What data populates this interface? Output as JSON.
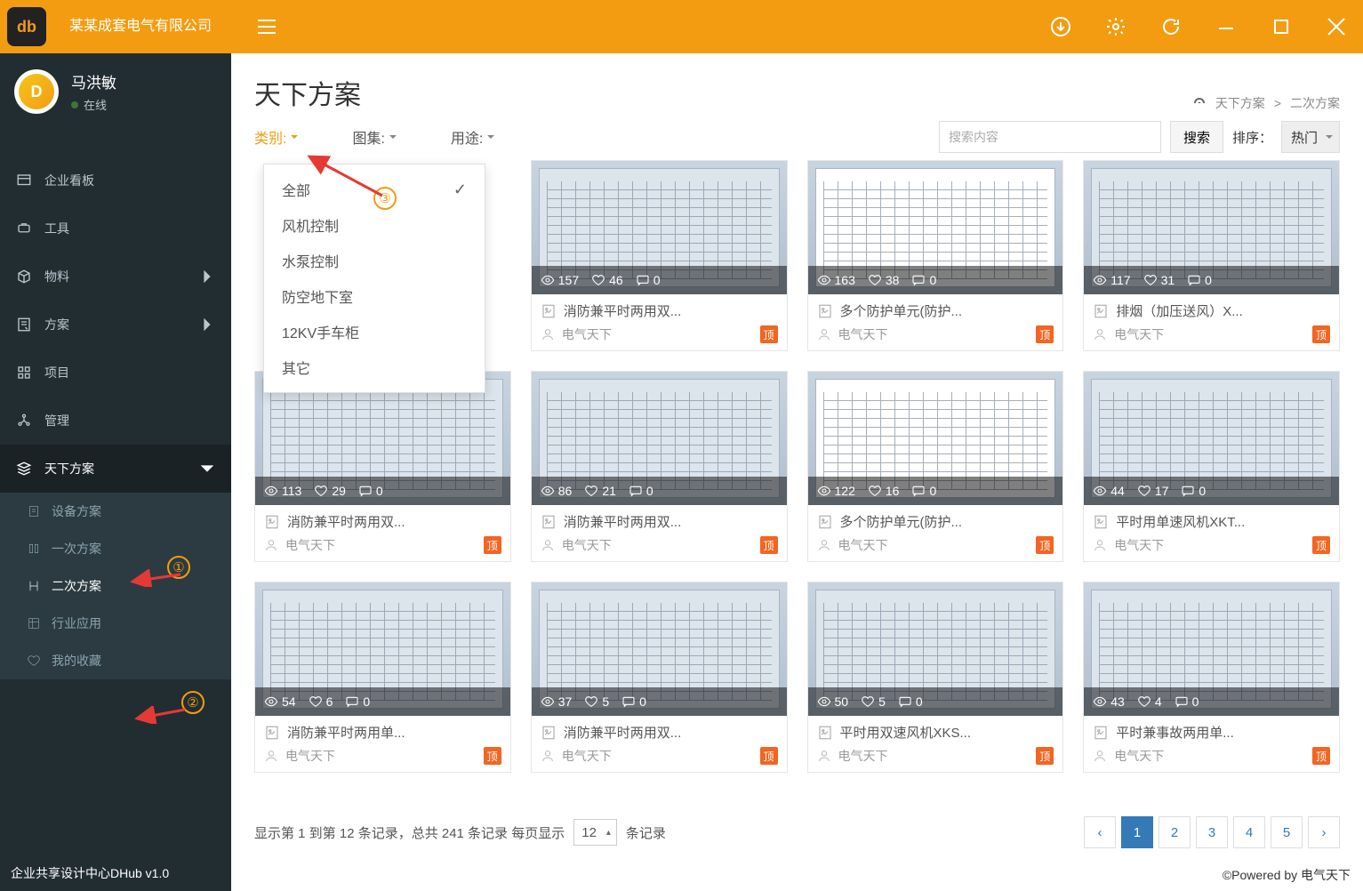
{
  "app": {
    "company": "某某成套电气有限公司",
    "footer_left": "企业共享设计中心DHub v1.0",
    "footer_right": "©Powered by 电气天下"
  },
  "user": {
    "name": "马洪敏",
    "status": "在线"
  },
  "sidebar": {
    "items": [
      {
        "label": "企业看板"
      },
      {
        "label": "工具"
      },
      {
        "label": "物料"
      },
      {
        "label": "方案"
      },
      {
        "label": "项目"
      },
      {
        "label": "管理"
      },
      {
        "label": "天下方案"
      }
    ],
    "sub": [
      {
        "label": "设备方案"
      },
      {
        "label": "一次方案"
      },
      {
        "label": "二次方案"
      },
      {
        "label": "行业应用"
      },
      {
        "label": "我的收藏"
      }
    ]
  },
  "page": {
    "title": "天下方案",
    "breadcrumb_root": "天下方案",
    "breadcrumb_leaf": "二次方案"
  },
  "filters": {
    "category": "类别:",
    "gallery": "图集:",
    "usage": "用途:"
  },
  "dropdown": [
    "全部",
    "风机控制",
    "水泵控制",
    "防空地下室",
    "12KV手车柜",
    "其它"
  ],
  "search": {
    "placeholder": "搜索内容",
    "btn": "搜索"
  },
  "sort": {
    "label": "排序：",
    "value": "热门"
  },
  "cards": [
    {
      "views": "157",
      "likes": "46",
      "comments": "0",
      "title": "消防兼平时两用双...",
      "author": "电气天下"
    },
    {
      "views": "163",
      "likes": "38",
      "comments": "0",
      "title": "多个防护单元(防护...",
      "author": "电气天下",
      "white": true
    },
    {
      "views": "117",
      "likes": "31",
      "comments": "0",
      "title": "排烟（加压送风）X...",
      "author": "电气天下"
    },
    {
      "views": "113",
      "likes": "29",
      "comments": "0",
      "title": "消防兼平时两用双...",
      "author": "电气天下"
    },
    {
      "views": "86",
      "likes": "21",
      "comments": "0",
      "title": "消防兼平时两用双...",
      "author": "电气天下"
    },
    {
      "views": "122",
      "likes": "16",
      "comments": "0",
      "title": "多个防护单元(防护...",
      "author": "电气天下",
      "white": true
    },
    {
      "views": "44",
      "likes": "17",
      "comments": "0",
      "title": "平时用单速风机XKT...",
      "author": "电气天下"
    },
    {
      "views": "54",
      "likes": "6",
      "comments": "0",
      "title": "消防兼平时两用单...",
      "author": "电气天下"
    },
    {
      "views": "37",
      "likes": "5",
      "comments": "0",
      "title": "消防兼平时两用双...",
      "author": "电气天下"
    },
    {
      "views": "50",
      "likes": "5",
      "comments": "0",
      "title": "平时用双速风机XKS...",
      "author": "电气天下"
    },
    {
      "views": "43",
      "likes": "4",
      "comments": "0",
      "title": "平时兼事故两用单...",
      "author": "电气天下"
    }
  ],
  "pager": {
    "summary_pre": "显示第 1 到第 12 条记录，总共 241 条记录 每页显示",
    "per_page": "12",
    "summary_post": "条记录",
    "pages": [
      "1",
      "2",
      "3",
      "4",
      "5"
    ]
  }
}
